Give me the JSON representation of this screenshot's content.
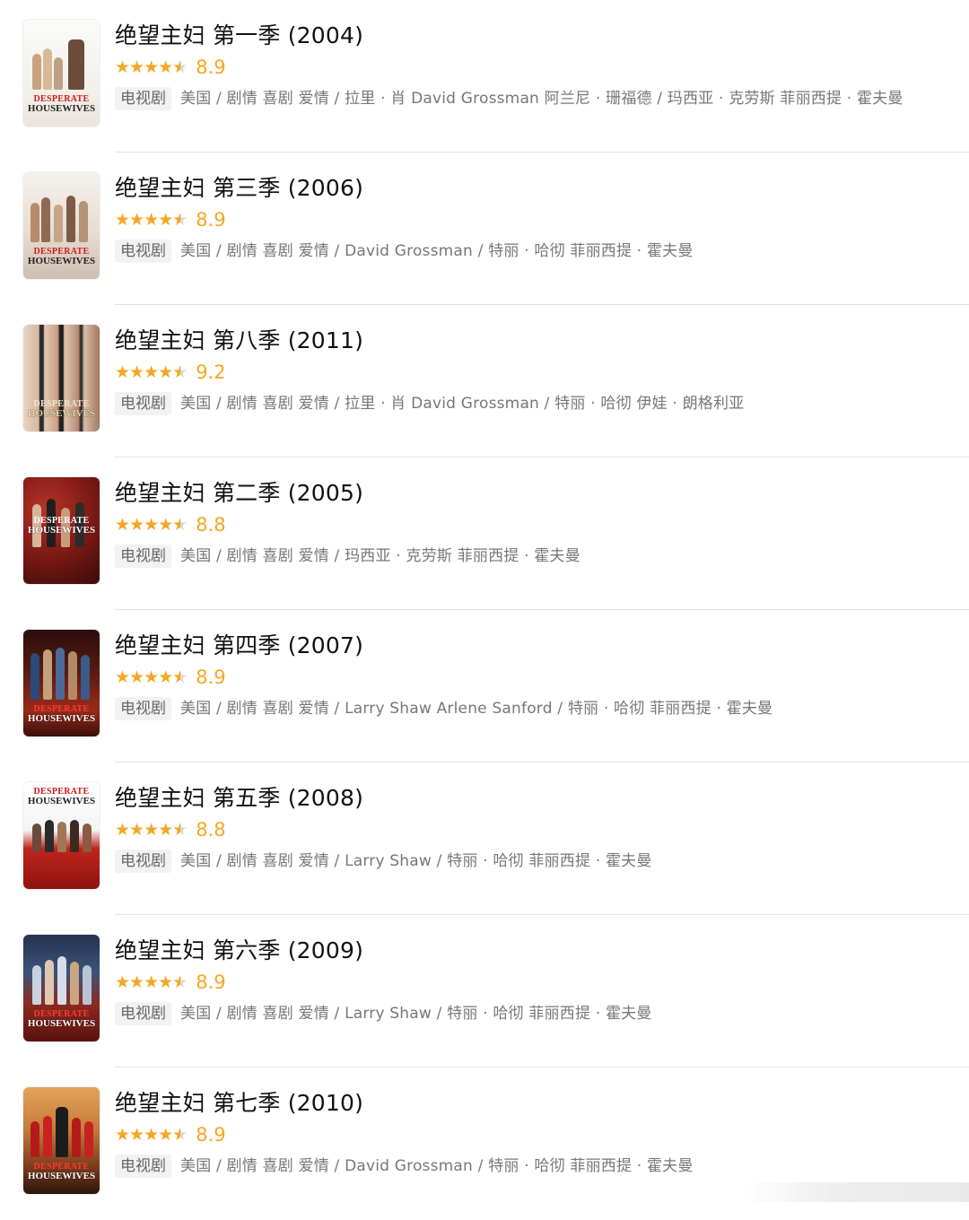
{
  "colors": {
    "star": "#f5a623",
    "score": "#f5a623",
    "tag_bg": "#f2f2f2",
    "divider": "#e3e3e3"
  },
  "items": [
    {
      "title": "绝望主妇 第一季 (2004)",
      "score": "8.9",
      "stars": 4.5,
      "tag": "电视剧",
      "meta": "美国 / 剧情 喜剧 爱情 / 拉里 · 肖 David Grossman 阿兰尼 · 珊福德 / 玛西亚 · 克劳斯 菲丽西提 · 霍夫曼",
      "poster_text_1": "DESPERATE",
      "poster_text_2": "HOUSEWIVES",
      "poster_icon": "poster-season-1-icon"
    },
    {
      "title": "绝望主妇 第三季 (2006)",
      "score": "8.9",
      "stars": 4.5,
      "tag": "电视剧",
      "meta": "美国 / 剧情 喜剧 爱情 / David Grossman / 特丽 · 哈彻 菲丽西提 · 霍夫曼",
      "poster_text_1": "DESPERATE",
      "poster_text_2": "HOUSEWIVES",
      "poster_icon": "poster-season-3-icon"
    },
    {
      "title": "绝望主妇  第八季 (2011)",
      "score": "9.2",
      "stars": 4.5,
      "tag": "电视剧",
      "meta": "美国 / 剧情 喜剧 爱情 / 拉里 · 肖 David Grossman / 特丽 · 哈彻 伊娃 · 朗格利亚",
      "poster_text_1": "DESPERATE",
      "poster_text_2": "HOUSEWIVES",
      "poster_icon": "poster-season-8-icon"
    },
    {
      "title": "绝望主妇 第二季 (2005)",
      "score": "8.8",
      "stars": 4.5,
      "tag": "电视剧",
      "meta": "美国 / 剧情 喜剧 爱情 / 玛西亚 · 克劳斯 菲丽西提 · 霍夫曼",
      "poster_text_1": "DESPERATE",
      "poster_text_2": "HOUSEWIVES",
      "poster_icon": "poster-season-2-icon"
    },
    {
      "title": "绝望主妇 第四季 (2007)",
      "score": "8.9",
      "stars": 4.5,
      "tag": "电视剧",
      "meta": "美国 / 剧情 喜剧 爱情 / Larry Shaw Arlene Sanford / 特丽 · 哈彻 菲丽西提 · 霍夫曼",
      "poster_text_1": "DESPERATE",
      "poster_text_2": "HOUSEWIVES",
      "poster_icon": "poster-season-4-icon"
    },
    {
      "title": "绝望主妇 第五季 (2008)",
      "score": "8.8",
      "stars": 4.5,
      "tag": "电视剧",
      "meta": "美国 / 剧情 喜剧 爱情 / Larry Shaw / 特丽 · 哈彻 菲丽西提 · 霍夫曼",
      "poster_text_1": "DESPERATE",
      "poster_text_2": "HOUSEWIVES",
      "poster_icon": "poster-season-5-icon"
    },
    {
      "title": "绝望主妇 第六季 (2009)",
      "score": "8.9",
      "stars": 4.5,
      "tag": "电视剧",
      "meta": "美国 / 剧情 喜剧 爱情 / Larry Shaw / 特丽 · 哈彻 菲丽西提 · 霍夫曼",
      "poster_text_1": "DESPERATE",
      "poster_text_2": "HOUSEWIVES",
      "poster_icon": "poster-season-6-icon"
    },
    {
      "title": "绝望主妇 第七季 (2010)",
      "score": "8.9",
      "stars": 4.5,
      "tag": "电视剧",
      "meta": "美国 / 剧情 喜剧 爱情 / David Grossman / 特丽 · 哈彻 菲丽西提 · 霍夫曼",
      "poster_text_1": "DESPERATE",
      "poster_text_2": "HOUSEWIVES",
      "poster_icon": "poster-season-7-icon"
    }
  ]
}
